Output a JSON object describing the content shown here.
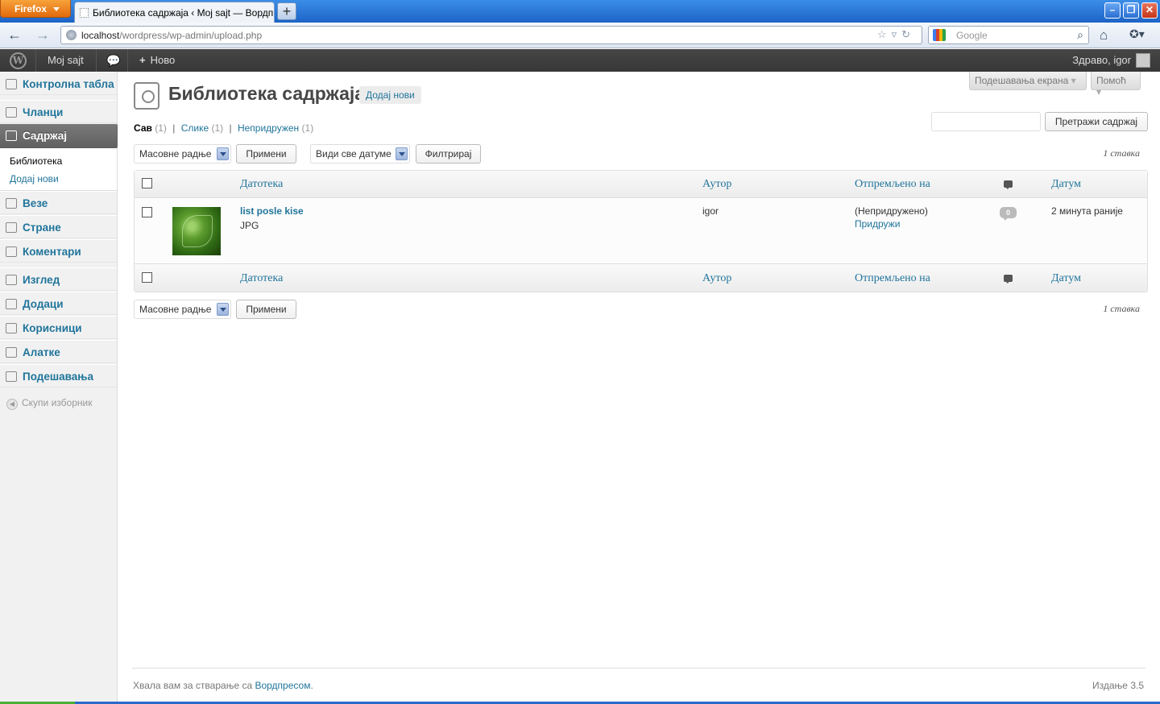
{
  "browser": {
    "menu_label": "Firefox",
    "tab_title": "Библиотека садржаја ‹ Moj sajt — Вордпрес",
    "new_tab_label": "+",
    "url_host": "localhost",
    "url_path": "/wordpress/wp-admin/upload.php",
    "search_placeholder": "Google"
  },
  "adminbar": {
    "logo": "W",
    "site_name": "Moj sajt",
    "new_label": "Ново",
    "greeting": "Здраво, igor"
  },
  "sidebar": {
    "items": [
      {
        "label": "Контролна табла",
        "icon": "home-icon"
      },
      {
        "label": "Чланци",
        "icon": "pin-icon"
      },
      {
        "label": "Садржај",
        "icon": "media-icon"
      },
      {
        "label": "Везе",
        "icon": "link-icon"
      },
      {
        "label": "Стране",
        "icon": "page-icon"
      },
      {
        "label": "Коментари",
        "icon": "comment-icon"
      },
      {
        "label": "Изглед",
        "icon": "appearance-icon"
      },
      {
        "label": "Додаци",
        "icon": "plugin-icon"
      },
      {
        "label": "Корисници",
        "icon": "users-icon"
      },
      {
        "label": "Алатке",
        "icon": "tools-icon"
      },
      {
        "label": "Подешавања",
        "icon": "settings-icon"
      }
    ],
    "submenu": [
      "Библиотека",
      "Додај нови"
    ],
    "collapse_label": "Скупи изборник"
  },
  "header": {
    "screen_options": "Подешавања екрана",
    "help": "Помоћ",
    "title": "Библиотека садржаја",
    "add_new": "Додај нови"
  },
  "filters": {
    "all": "Сав",
    "all_count": "(1)",
    "images": "Слике",
    "images_count": "(1)",
    "unattached": "Непридружен",
    "unattached_count": "(1)",
    "sep": "|"
  },
  "search": {
    "button": "Претражи садржај",
    "value": ""
  },
  "toolbar": {
    "bulk_actions": "Масовне радње",
    "apply": "Примени",
    "dates": "Види све датуме",
    "filter": "Филтрирај",
    "item_count": "1 ставка"
  },
  "table": {
    "columns": {
      "file": "Датотека",
      "author": "Аутор",
      "uploaded_to": "Отпремљено на",
      "date": "Датум"
    },
    "rows": [
      {
        "title": "list posle kise",
        "type": "JPG",
        "author": "igor",
        "uploaded_to": "(Непридружено)",
        "attach": "Придружи",
        "comments": "0",
        "date": "2 минута раније"
      }
    ]
  },
  "footer": {
    "thanks": "Хвала вам за стварање са",
    "link": "Вордпресом",
    "period": ".",
    "version": "Издање 3.5"
  },
  "colors": {
    "link": "#21759b",
    "adminbar": "#464646",
    "active_menu": "#6d6d6d"
  }
}
